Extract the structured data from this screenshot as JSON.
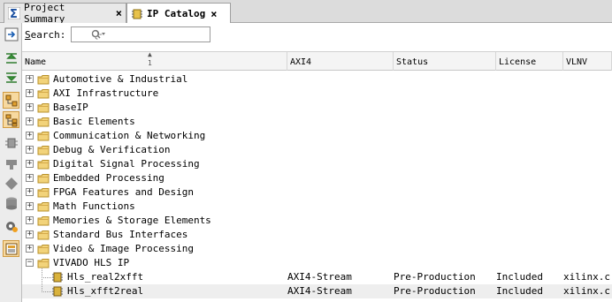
{
  "tabs": [
    {
      "label": "Project Summary",
      "icon": "sigma-icon"
    },
    {
      "label": "IP Catalog",
      "icon": "ip-catalog-icon"
    }
  ],
  "search": {
    "label_u": "S",
    "label_rest": "earch:",
    "placeholder": "Q-"
  },
  "sort_indicator": "1",
  "columns": [
    "Name",
    "AXI4",
    "Status",
    "License",
    "VLNV"
  ],
  "categories": [
    "Automotive & Industrial",
    "AXI Infrastructure",
    "BaseIP",
    "Basic Elements",
    "Communication & Networking",
    "Debug & Verification",
    "Digital Signal Processing",
    "Embedded Processing",
    "FPGA Features and Design",
    "Math Functions",
    "Memories & Storage Elements",
    "Standard Bus Interfaces",
    "Video & Image Processing",
    "VIVADO HLS IP"
  ],
  "ips": [
    {
      "name": "Hls_real2xfft",
      "axi4": "AXI4-Stream",
      "status": "Pre-Production",
      "license": "Included",
      "vlnv": "xilinx.c."
    },
    {
      "name": "Hls_xfft2real",
      "axi4": "AXI4-Stream",
      "status": "Pre-Production",
      "license": "Included",
      "vlnv": "xilinx.c."
    }
  ]
}
